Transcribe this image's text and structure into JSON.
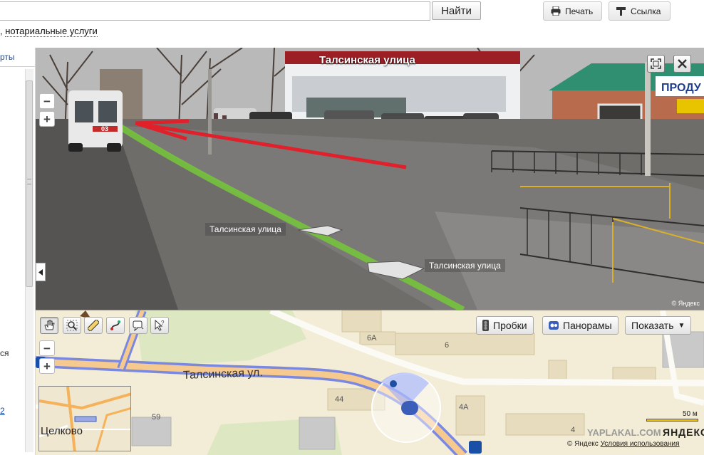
{
  "header": {
    "find_label": "Найти",
    "print_label": "Печать",
    "link_label": "Ссылка",
    "suggest_text": "нотариальные услуги",
    "suggest_prefix": ","
  },
  "left_panel": {
    "tab_label": "рты",
    "snippet_1": "ся",
    "snippet_2": "2"
  },
  "panorama": {
    "title": "Талсинская улица",
    "street_tag_1": "Талсинская улица",
    "street_tag_2": "Талсинская улица",
    "copyright": "© Яндекс",
    "zoom_out": "−",
    "zoom_in": "+",
    "fullscreen_icon": "fullscreen-icon",
    "close_icon": "close-icon",
    "ambulance_number": "03",
    "shop_sign": "ПРОДУ"
  },
  "map": {
    "traffic_label": "Пробки",
    "panoramas_label": "Панорамы",
    "show_label": "Показать",
    "show_arrow": "▼",
    "street_label": "Талсинская ул.",
    "house_labels": [
      "6А",
      "6",
      "4А",
      "4",
      "44",
      "59"
    ],
    "minimap_label": "Целково",
    "scale": "50 м",
    "logo": "ЯНДЕКС",
    "copyright": "© Яндекс",
    "terms": "Условия использования",
    "watermark": "YAPLAKAL.COM",
    "zoom_out": "−",
    "zoom_in": "+"
  },
  "colors": {
    "road_highlight": "#7a88e0",
    "road_fill": "#f6c98e",
    "map_bg": "#f3ecd6",
    "green_area": "#dde8c2",
    "arrow_red": "#e0202a",
    "link_blue": "#1a4fa8"
  }
}
